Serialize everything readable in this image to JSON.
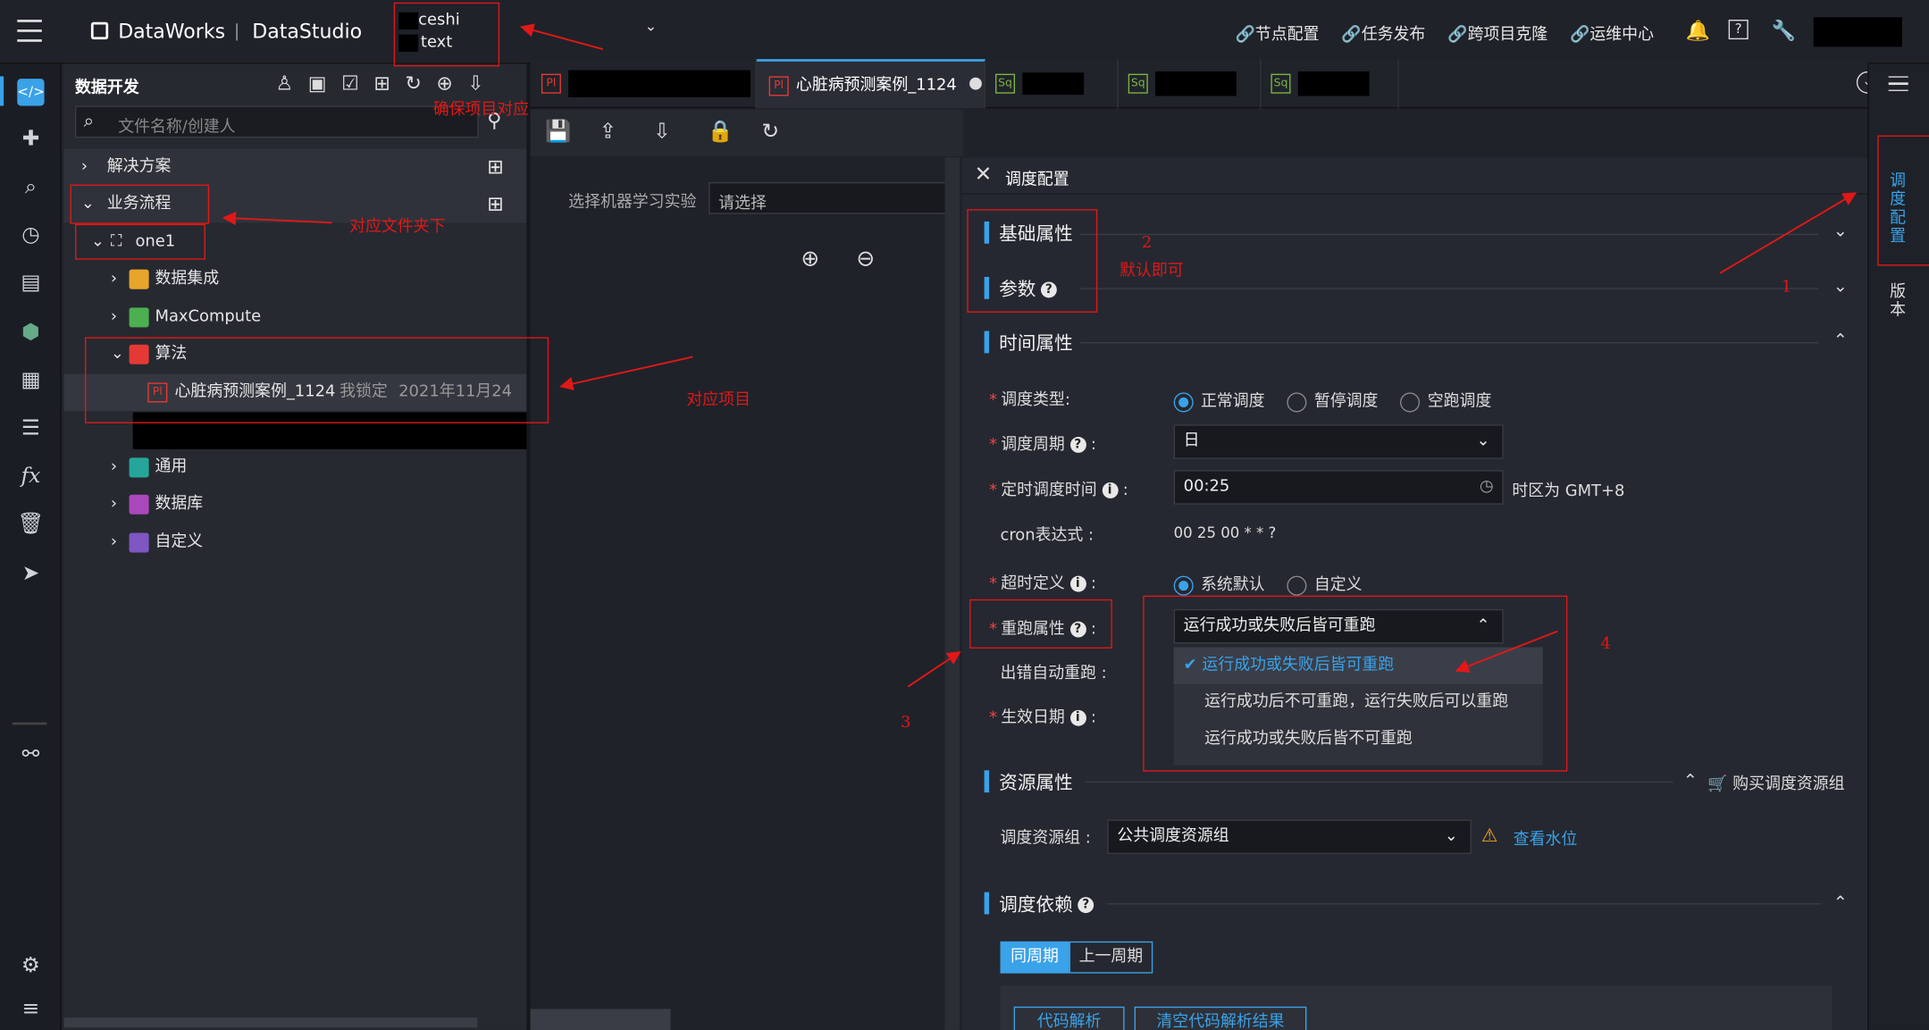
{
  "header": {
    "app_name": "DataWorks",
    "module": "DataStudio",
    "project_line1": "ceshi",
    "project_line2": "text",
    "nav": [
      "节点配置",
      "任务发布",
      "跨项目克隆",
      "运维中心"
    ]
  },
  "left_nav": {
    "icons": [
      "code-icon",
      "puzzle-icon",
      "search-icon",
      "clock-icon",
      "toolbox-icon",
      "cube-icon",
      "table-icon",
      "list-icon",
      "fx-icon",
      "trash-icon",
      "cursor-icon",
      "graph-icon",
      "settings-icon",
      "menu-icon"
    ]
  },
  "side": {
    "title": "数据开发",
    "search_placeholder": "文件名称/创建人",
    "tree": {
      "solutions": "解决方案",
      "workflows": "业务流程",
      "one1": "one1",
      "data_integration": "数据集成",
      "maxcompute": "MaxCompute",
      "algorithm": "算法",
      "node_name": "心脏病预测案例_1124",
      "node_lock": "我锁定",
      "node_date": "2021年11月24日",
      "general": "通用",
      "database": "数据库",
      "custom": "自定义"
    }
  },
  "tabs": {
    "active": "心脏病预测案例_1124",
    "badge_pl": "Pl",
    "badge_sq": "Sq"
  },
  "canvas": {
    "select_label": "选择机器学习实验",
    "select_placeholder": "请选择"
  },
  "panel": {
    "title": "调度配置",
    "sections": {
      "basic": "基础属性",
      "params": "参数",
      "time": "时间属性",
      "resource": "资源属性",
      "dependency": "调度依赖"
    },
    "sched_type": {
      "label": "调度类型",
      "options": [
        "正常调度",
        "暂停调度",
        "空跑调度"
      ]
    },
    "cycle": {
      "label": "调度周期",
      "value": "日"
    },
    "timing": {
      "label": "定时调度时间",
      "value": "00:25",
      "tz": "时区为 GMT+8"
    },
    "cron": {
      "label": "cron表达式",
      "value": "00 25 00 * * ?"
    },
    "timeout": {
      "label": "超时定义",
      "options": [
        "系统默认",
        "自定义"
      ]
    },
    "rerun": {
      "label": "重跑属性",
      "value": "运行成功或失败后皆可重跑",
      "options": [
        "运行成功或失败后皆可重跑",
        "运行成功后不可重跑，运行失败后可以重跑",
        "运行成功或失败后皆不可重跑"
      ]
    },
    "auto_rerun": {
      "label": "出错自动重跑"
    },
    "effective": {
      "label": "生效日期"
    },
    "buy": "购买调度资源组",
    "resource_group": {
      "label": "调度资源组",
      "value": "公共调度资源组",
      "watermark": "查看水位"
    },
    "dep_tabs": [
      "同周期",
      "上一周期"
    ],
    "dep_buttons": [
      "代码解析",
      "清空代码解析结果"
    ]
  },
  "right_tabs": {
    "schedule": "调度配置",
    "version": "版本"
  },
  "annotations": {
    "ensure_project": "确保项目对应",
    "folder": "对应文件夹下",
    "project": "对应项目",
    "default_ok": "默认即可",
    "n1": "1",
    "n2": "2",
    "n3": "3",
    "n4": "4"
  }
}
